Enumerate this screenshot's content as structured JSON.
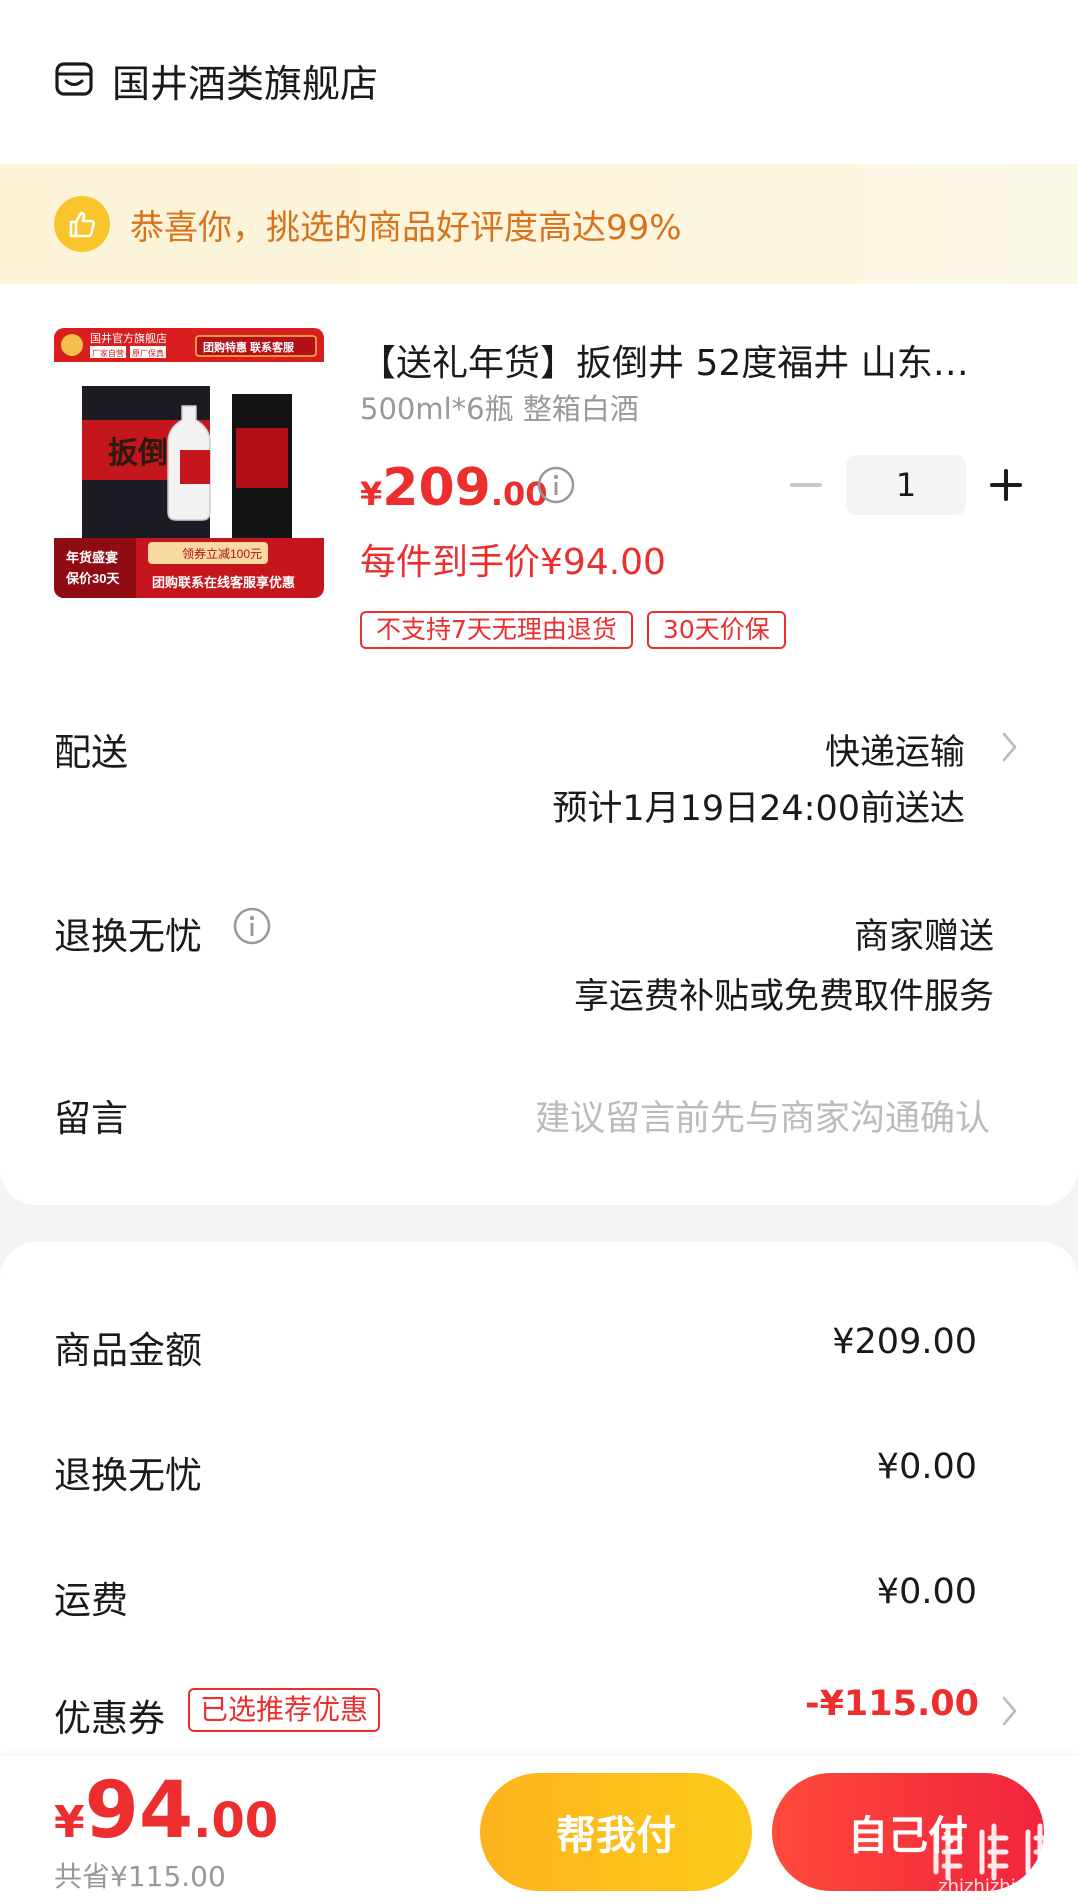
{
  "store": {
    "name": "国井酒类旗舰店"
  },
  "banner": {
    "text": "恭喜你，挑选的商品好评度高达99%"
  },
  "product": {
    "title": "【送礼年货】扳倒井 52度福井 山东…",
    "spec": "500ml*6瓶 整箱白酒",
    "price_currency": "¥",
    "price_integer": "209",
    "price_decimal": ".00",
    "quantity": "1",
    "unit_price_text": "每件到手价¥94.00",
    "tags": [
      "不支持7天无理由退货",
      "30天价保"
    ],
    "image": {
      "header": "国井官方旗舰店",
      "header_sub1": "厂家自营",
      "header_sub2": "原厂保真",
      "promo": "团购特惠 联系客服",
      "bottle_label": "扳倒井",
      "festival1": "年货盛宴",
      "festival2": "保价30天",
      "coupon": "领券立减100元",
      "contact": "团购联系在线客服享优惠"
    }
  },
  "delivery": {
    "label": "配送",
    "method": "快递运输",
    "eta": "预计1月19日24:00前送达"
  },
  "return_service": {
    "label": "退换无忧",
    "provider": "商家赠送",
    "desc": "享运费补贴或免费取件服务"
  },
  "message": {
    "label": "留言",
    "placeholder": "建议留言前先与商家沟通确认"
  },
  "fees": {
    "goods_label": "商品金额",
    "goods_value": "¥209.00",
    "return_label": "退换无忧",
    "return_value": "¥0.00",
    "shipping_label": "运费",
    "shipping_value": "¥0.00",
    "coupon_label": "优惠券",
    "coupon_tag": "已选推荐优惠",
    "coupon_value": "-¥115.00"
  },
  "bottom": {
    "currency": "¥",
    "total_integer": "94",
    "total_decimal": ".00",
    "saved": "共省¥115.00",
    "help_pay": "帮我付",
    "self_pay": "自己付"
  },
  "watermark": {
    "text": "zhizhizhi.com"
  },
  "colors": {
    "accent_red": "#ec2e2e",
    "banner_orange": "#d8731d",
    "yellow": "#f9c52a"
  }
}
